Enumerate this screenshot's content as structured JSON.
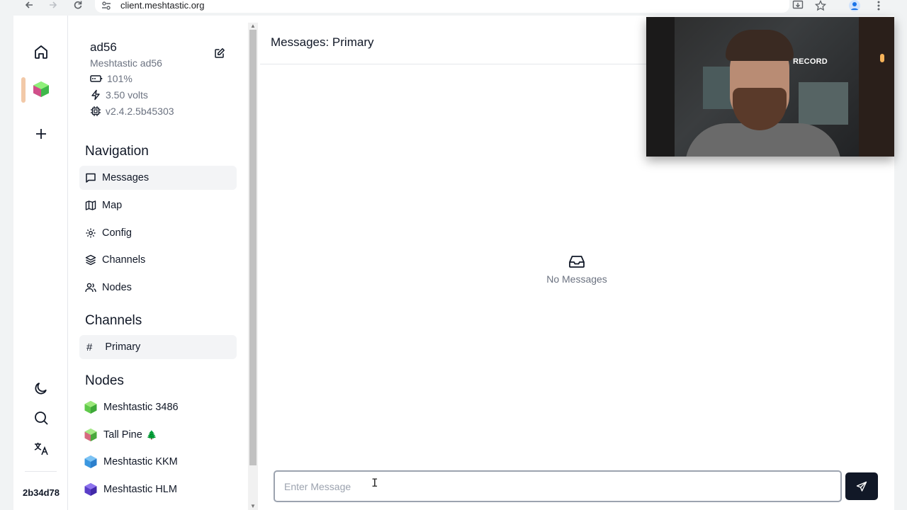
{
  "browser": {
    "url": "client.meshtastic.org"
  },
  "rail": {
    "node_id": "2b34d78"
  },
  "device": {
    "short_name": "ad56",
    "long_name": "Meshtastic ad56",
    "battery": "101%",
    "voltage": "3.50 volts",
    "firmware": "v2.4.2.5b45303"
  },
  "navigation": {
    "title": "Navigation",
    "items": [
      {
        "label": "Messages",
        "icon": "message-square-icon"
      },
      {
        "label": "Map",
        "icon": "map-icon"
      },
      {
        "label": "Config",
        "icon": "gear-icon"
      },
      {
        "label": "Channels",
        "icon": "layers-icon"
      },
      {
        "label": "Nodes",
        "icon": "users-icon"
      }
    ]
  },
  "channels": {
    "title": "Channels",
    "items": [
      {
        "label": "Primary"
      }
    ]
  },
  "nodes": {
    "title": "Nodes",
    "items": [
      {
        "label": "Meshtastic 3486",
        "color": "#7ed957"
      },
      {
        "label": "Tall Pine",
        "emoji": "🌲",
        "color": "#7ed957"
      },
      {
        "label": "Meshtastic KKM",
        "color": "#4aa8e8"
      },
      {
        "label": "Meshtastic HLM",
        "color": "#6b4ad6"
      }
    ]
  },
  "main": {
    "title": "Messages: Primary",
    "empty_text": "No Messages",
    "input_placeholder": "Enter Message"
  },
  "webcam": {
    "label": "RECORD"
  },
  "colors": {
    "accent_dark": "#111827",
    "muted_text": "#6b7280",
    "active_bg": "#f3f4f6",
    "rail_indicator": "#f2c9a8"
  }
}
